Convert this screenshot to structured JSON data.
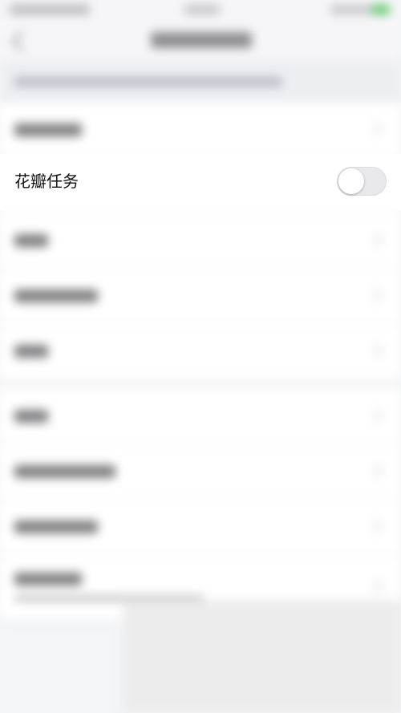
{
  "setting": {
    "label": "花瓣任务",
    "enabled": false
  },
  "colors": {
    "toggle_off_track": "#e9e9eb",
    "toggle_knob": "#ffffff",
    "background": "#f4f5f7"
  },
  "icons": {
    "back": "chevron-left-icon",
    "row_arrow": "chevron-right-icon"
  }
}
